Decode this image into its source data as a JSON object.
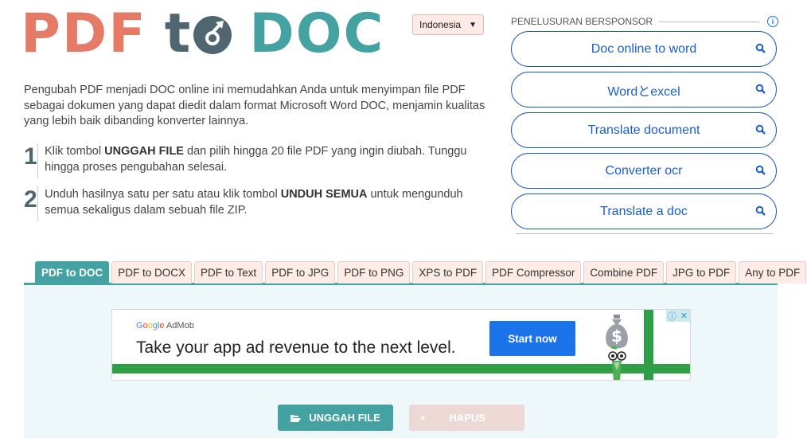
{
  "logo": {
    "part1": "PDF",
    "part2_t": "t",
    "part3": "DOC"
  },
  "language_select": {
    "value": "Indonesia"
  },
  "intro": "Pengubah PDF menjadi DOC online ini memudahkan Anda untuk menyimpan file PDF sebagai dokumen yang dapat diedit dalam format Microsoft Word DOC, menjamin kualitas yang lebih baik dibanding konverter lainnya.",
  "steps": [
    {
      "number": "1",
      "pre": "Klik tombol ",
      "bold": "UNGGAH FILE",
      "post": " dan pilih hingga 20 file PDF yang ingin diubah. Tunggu hingga proses pengubahan selesai."
    },
    {
      "number": "2",
      "pre": "Unduh hasilnya satu per satu atau klik tombol ",
      "bold": "UNDUH SEMUA",
      "post": " untuk mengunduh semua sekaligus dalam sebuah file ZIP."
    }
  ],
  "sponsored": {
    "heading": "PENELUSURAN BERSPONSOR",
    "info_icon": "info-icon",
    "links": [
      "Doc online to word",
      "Wordとexcel",
      "Translate document",
      "Converter ocr",
      "Translate a doc"
    ]
  },
  "tabs": [
    "PDF to DOC",
    "PDF to DOCX",
    "PDF to Text",
    "PDF to JPG",
    "PDF to PNG",
    "XPS to PDF",
    "PDF Compressor",
    "Combine PDF",
    "JPG to PDF",
    "Any to PDF"
  ],
  "active_tab": "PDF to DOC",
  "ad": {
    "brand_google": [
      "G",
      "o",
      "o",
      "g",
      "l",
      "e"
    ],
    "brand_product": "AdMob",
    "headline": "Take your app ad revenue to the next level.",
    "cta": "Start now",
    "info_glyph": "ⓘ",
    "close_glyph": "✕"
  },
  "buttons": {
    "upload": "UNGGAH FILE",
    "delete": "HAPUS",
    "delete_glyph": "×"
  },
  "colors": {
    "pdf": "#e57a67",
    "to": "#4f6570",
    "doc": "#45a2a3",
    "sponsor_blue": "#1a5ecf",
    "ad_cta": "#1a73e8"
  }
}
